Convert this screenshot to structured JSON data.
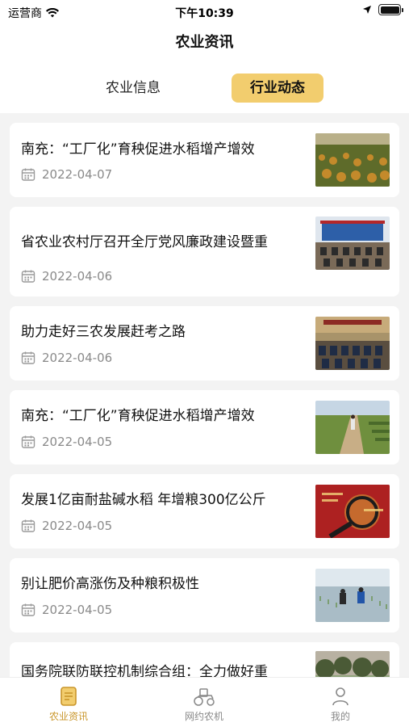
{
  "status_bar": {
    "carrier": "运营商",
    "time": "下午10:39"
  },
  "navbar": {
    "title": "农业资讯"
  },
  "tabs": [
    {
      "label": "农业信息"
    },
    {
      "label": "行业动态"
    }
  ],
  "news": [
    {
      "title": "南充：“工厂化”育秧促进水稻增产增效",
      "date": "2022-04-07",
      "thumb": "rice-field"
    },
    {
      "title": "省农业农村厅召开全厅党风廉政建设暨重",
      "date": "2022-04-06",
      "thumb": "meeting-hall"
    },
    {
      "title": "助力走好三农发展赶考之路",
      "date": "2022-04-06",
      "thumb": "conference"
    },
    {
      "title": "南充：“工厂化”育秧促进水稻增产增效",
      "date": "2022-04-05",
      "thumb": "farm-road"
    },
    {
      "title": "发展1亿亩耐盐碱水稻 年增粮300亿公斤",
      "date": "2022-04-05",
      "thumb": "register-magnifier"
    },
    {
      "title": "别让肥价高涨伤及种粮积极性",
      "date": "2022-04-05",
      "thumb": "farmers-planting"
    },
    {
      "title": "国务院联防联控机制综合组：全力做好重",
      "date": "",
      "thumb": "trees"
    }
  ],
  "tabbar": [
    {
      "label": "农业资讯"
    },
    {
      "label": "网约农机"
    },
    {
      "label": "我的"
    }
  ],
  "colors": {
    "accent": "#f2cd6e",
    "active_tab_text": "#c9962a"
  }
}
